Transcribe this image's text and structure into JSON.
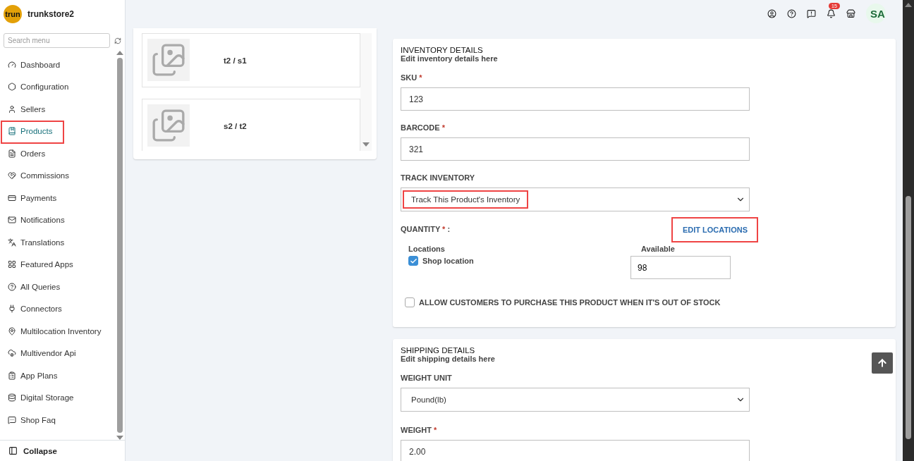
{
  "store": {
    "avatar_text": "trun",
    "name": "trunkstore2"
  },
  "search": {
    "placeholder": "Search menu"
  },
  "sidebar": {
    "items": [
      {
        "label": "Dashboard",
        "selected": false,
        "highlighted": false
      },
      {
        "label": "Configuration",
        "selected": false,
        "highlighted": false
      },
      {
        "label": "Sellers",
        "selected": false,
        "highlighted": false
      },
      {
        "label": "Products",
        "selected": true,
        "highlighted": true
      },
      {
        "label": "Orders",
        "selected": false,
        "highlighted": false
      },
      {
        "label": "Commissions",
        "selected": false,
        "highlighted": false
      },
      {
        "label": "Payments",
        "selected": false,
        "highlighted": false
      },
      {
        "label": "Notifications",
        "selected": false,
        "highlighted": false
      },
      {
        "label": "Translations",
        "selected": false,
        "highlighted": false
      },
      {
        "label": "Featured Apps",
        "selected": false,
        "highlighted": false
      },
      {
        "label": "All Queries",
        "selected": false,
        "highlighted": false
      },
      {
        "label": "Connectors",
        "selected": false,
        "highlighted": false
      },
      {
        "label": "Multilocation Inventory",
        "selected": false,
        "highlighted": false
      },
      {
        "label": "Multivendor Api",
        "selected": false,
        "highlighted": false
      },
      {
        "label": "App Plans",
        "selected": false,
        "highlighted": false
      },
      {
        "label": "Digital Storage",
        "selected": false,
        "highlighted": false
      },
      {
        "label": "Shop Faq",
        "selected": false,
        "highlighted": false
      }
    ],
    "collapse": "Collapse"
  },
  "topbar": {
    "notification_count": "15",
    "user_initials": "SA"
  },
  "variants": [
    {
      "title": "t2 / s1"
    },
    {
      "title": "s2 / t2"
    }
  ],
  "inventory": {
    "title": "INVENTORY DETAILS",
    "subtitle": "Edit inventory details here",
    "sku": {
      "label": "SKU",
      "required_mark": "*",
      "value": "123"
    },
    "barcode": {
      "label": "BARCODE",
      "required_mark": "*",
      "value": "321"
    },
    "track": {
      "label": "TRACK INVENTORY",
      "value": "Track This Product's Inventory",
      "highlighted": true
    },
    "quantity": {
      "label": "QUANTITY",
      "required_mark": "*",
      "suffix": ":"
    },
    "edit_locations": {
      "label": "EDIT LOCATIONS",
      "highlighted": true
    },
    "columns": [
      "Locations",
      "Available"
    ],
    "locations": [
      {
        "name": "Shop location",
        "checked": true,
        "available": "98"
      }
    ],
    "allow_oversell": {
      "label": "ALLOW CUSTOMERS TO PURCHASE THIS PRODUCT WHEN IT'S OUT OF STOCK",
      "checked": false
    }
  },
  "shipping": {
    "title": "SHIPPING DETAILS",
    "subtitle": "Edit shipping details here",
    "weight_unit": {
      "label": "WEIGHT UNIT",
      "value": "Pound(lb)"
    },
    "weight": {
      "label": "WEIGHT",
      "required_mark": "*",
      "value": "2.00"
    }
  }
}
